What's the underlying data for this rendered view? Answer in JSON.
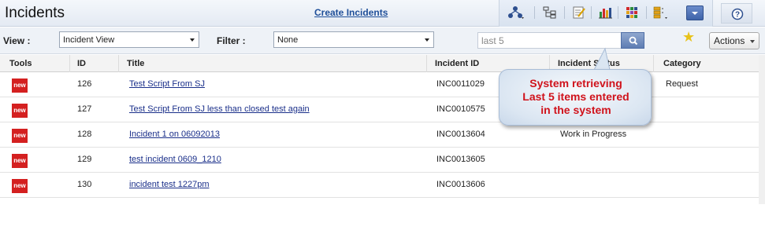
{
  "header": {
    "title": "Incidents",
    "create_link": "Create Incidents",
    "toolbar_icons": [
      "org-chart-icon",
      "hierarchy-icon",
      "edit-checklist-icon",
      "bar-chart-icon",
      "grid-icon",
      "layout-icon"
    ],
    "dropdown_icon": "chevron-down-icon",
    "help_icon": "help-icon"
  },
  "filters": {
    "view_label": "View :",
    "view_value": "Incident View",
    "filter_label": "Filter :",
    "filter_value": "None",
    "search_value": "last 5",
    "actions_label": "Actions"
  },
  "table": {
    "columns": [
      "Tools",
      "ID",
      "Title",
      "Incident ID",
      "Incident Status",
      "Category"
    ],
    "badge_label": "new",
    "rows": [
      {
        "id": "126",
        "title": "Test Script From SJ",
        "incident_id": "INC0011029",
        "status": "",
        "category": "Request"
      },
      {
        "id": "127",
        "title": "Test Script From SJ less than closed   test again",
        "incident_id": "INC0010575",
        "status": "",
        "category": ""
      },
      {
        "id": "128",
        "title": "Incident 1 on 06092013",
        "incident_id": "INC0013604",
        "status": "Work in Progress",
        "category": ""
      },
      {
        "id": "129",
        "title": "test incident 0609_1210",
        "incident_id": "INC0013605",
        "status": "",
        "category": ""
      },
      {
        "id": "130",
        "title": "incident test 1227pm",
        "incident_id": "INC0013606",
        "status": "",
        "category": ""
      }
    ]
  },
  "callout": {
    "lines": [
      "System retrieving",
      "Last 5 items entered",
      "in the system"
    ]
  },
  "colors": {
    "callout_text": "#d0121b",
    "badge": "#d42020",
    "link": "#1a2f8a"
  }
}
